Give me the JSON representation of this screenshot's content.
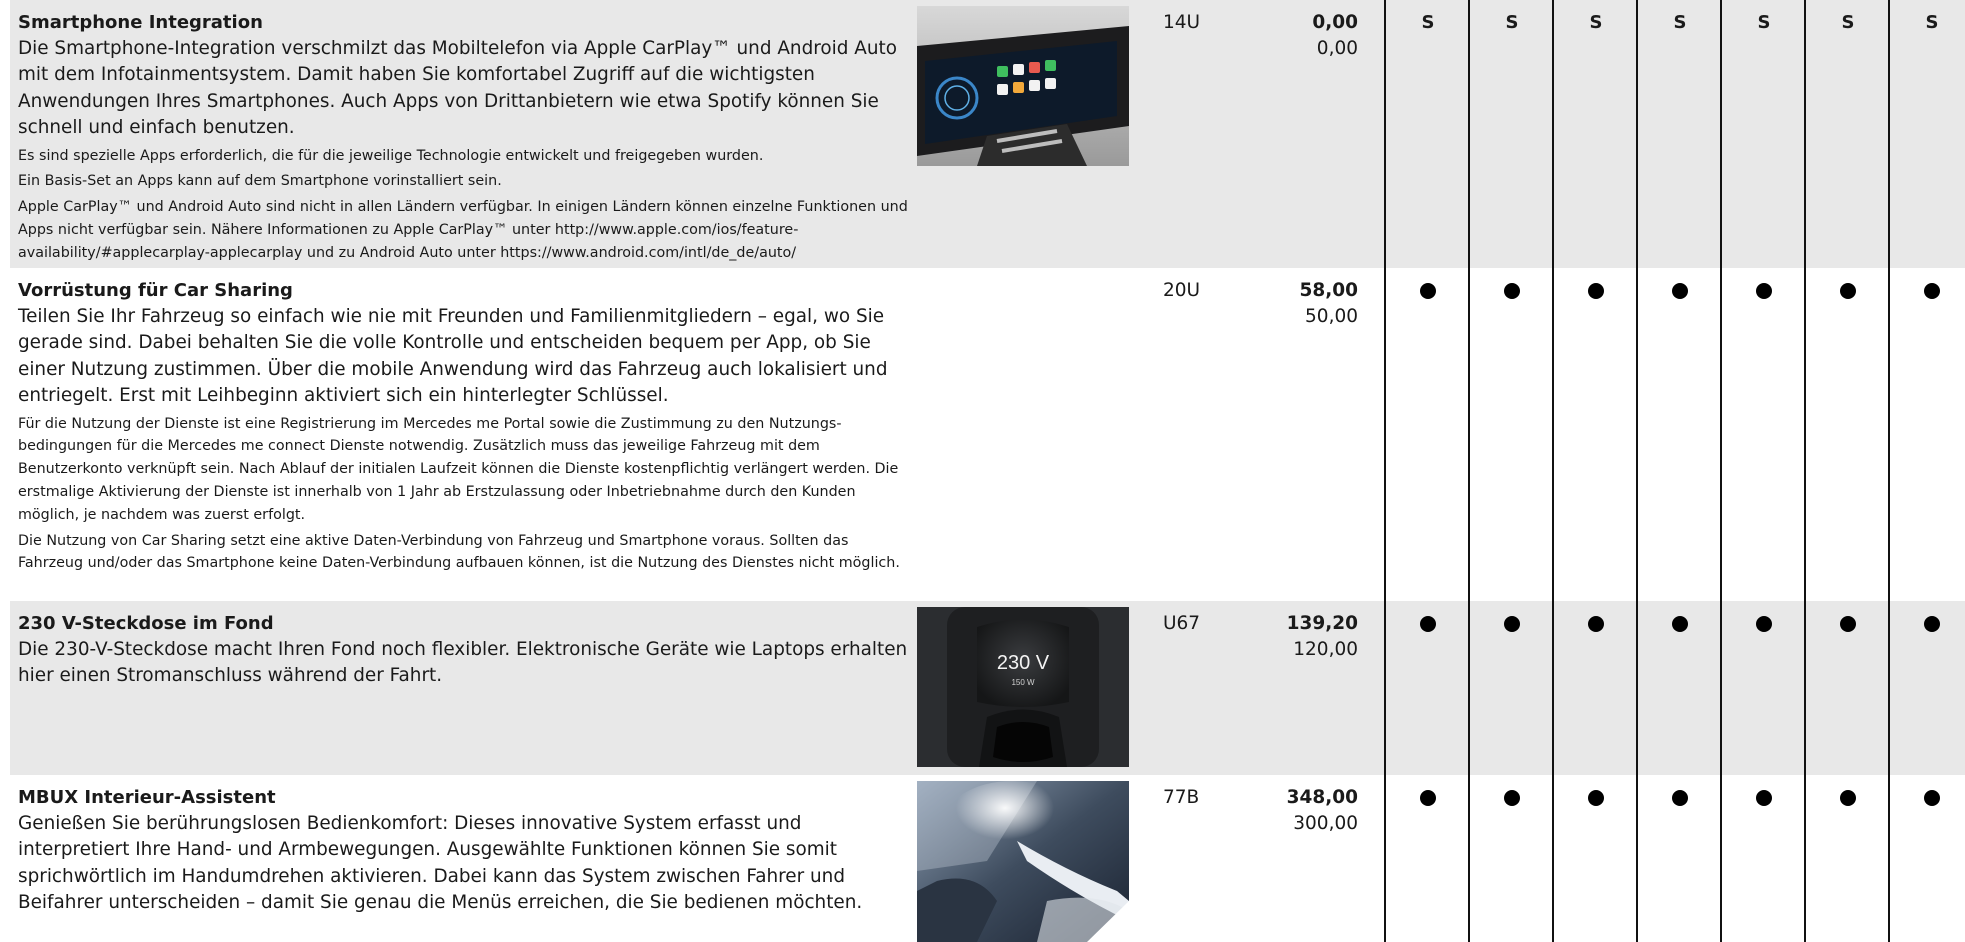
{
  "columns": {
    "count": 7
  },
  "rows": [
    {
      "title": "Smartphone Integration",
      "body": "Die Smartphone-Integration verschmilzt das Mobiltelefon via Apple CarPlay™ und Android Auto mit dem Infotainmentsystem. Damit haben Sie komfortabel Zugriff auf die wichtigsten Anwendungen Ihres Smartphones. Auch Apps von Drittanbietern wie etwa Spotify können Sie schnell und einfach benutzen.",
      "notes": [
        "Es sind spezielle Apps erforderlich, die für die jeweilige Technologie entwickelt und freigegeben wurden.",
        "Ein Basis-Set an Apps kann auf dem Smartphone vorinstalliert sein.",
        "Apple CarPlay™ und Android Auto sind nicht in allen Ländern verfügbar. In einigen Ländern können einzelne Funktionen und Apps nicht verfügbar sein. Nähere Informationen zu Apple CarPlay™ unter http://www.apple.com/ios/feature-availability/#applecarplay-applecarplay und zu Android Auto unter https://www.android.com/intl/de_de/auto/"
      ],
      "code": "14U",
      "price_gross": "0,00",
      "price_net": "0,00",
      "availability": [
        "S",
        "S",
        "S",
        "S",
        "S",
        "S",
        "S"
      ]
    },
    {
      "title": "Vorrüstung für Car Sharing",
      "body": "Teilen Sie Ihr Fahrzeug so einfach wie nie mit Freunden und Familienmitgliedern – egal, wo Sie gerade sind. Dabei behalten Sie die volle Kontrolle und entscheiden bequem per App, ob Sie einer Nutzung zustimmen. Über die mobile Anwendung wird das Fahrzeug auch lokalisiert und entriegelt. Erst mit Leihbeginn aktiviert sich ein hinterlegter Schlüssel.",
      "notes": [
        "Für die Nutzung der Dienste ist eine Registrierung im Mercedes me Portal sowie die Zustimmung zu den Nutzungs-bedingungen für die Mercedes me connect Dienste notwendig. Zusätzlich muss das jeweilige Fahrzeug mit dem Benutzerkonto verknüpft sein. Nach Ablauf der initialen Laufzeit können die Dienste kostenpflichtig verlängert werden. Die erstmalige Aktivierung der Dienste ist innerhalb von 1 Jahr ab Erstzulassung oder Inbetriebnahme durch den Kunden möglich, je nachdem was zuerst erfolgt.",
        "Die Nutzung von Car Sharing setzt eine aktive Daten-Verbindung von Fahrzeug und Smartphone voraus. Sollten das Fahrzeug und/oder das Smartphone keine Daten-Verbindung aufbauen können, ist die Nutzung des Dienstes nicht möglich."
      ],
      "code": "20U",
      "price_gross": "58,00",
      "price_net": "50,00",
      "availability": [
        "●",
        "●",
        "●",
        "●",
        "●",
        "●",
        "●"
      ]
    },
    {
      "title": "230 V-Steckdose im Fond",
      "body": "Die 230-V-Steckdose macht Ihren Fond noch flexibler. Elektronische Geräte wie Laptops erhalten hier einen Stromanschluss während der Fahrt.",
      "notes": [],
      "image_text": {
        "voltage": "230 V",
        "power": "150 W"
      },
      "code": "U67",
      "price_gross": "139,20",
      "price_net": "120,00",
      "availability": [
        "●",
        "●",
        "●",
        "●",
        "●",
        "●",
        "●"
      ]
    },
    {
      "title": "MBUX Interieur-Assistent",
      "body": "Genießen Sie berührungslosen Bedienkomfort: Dieses innovative System erfasst und interpretiert Ihre Hand- und Armbewegungen. Ausgewählte Funktionen können Sie somit sprichwörtlich im Handumdrehen aktivieren. Dabei kann das System zwischen Fahrer und Beifahrer unterscheiden – damit Sie genau die Menüs erreichen, die Sie bedienen möchten.",
      "notes": [],
      "code": "77B",
      "price_gross": "348,00",
      "price_net": "300,00",
      "availability": [
        "●",
        "●",
        "●",
        "●",
        "●",
        "●",
        "●"
      ]
    }
  ]
}
